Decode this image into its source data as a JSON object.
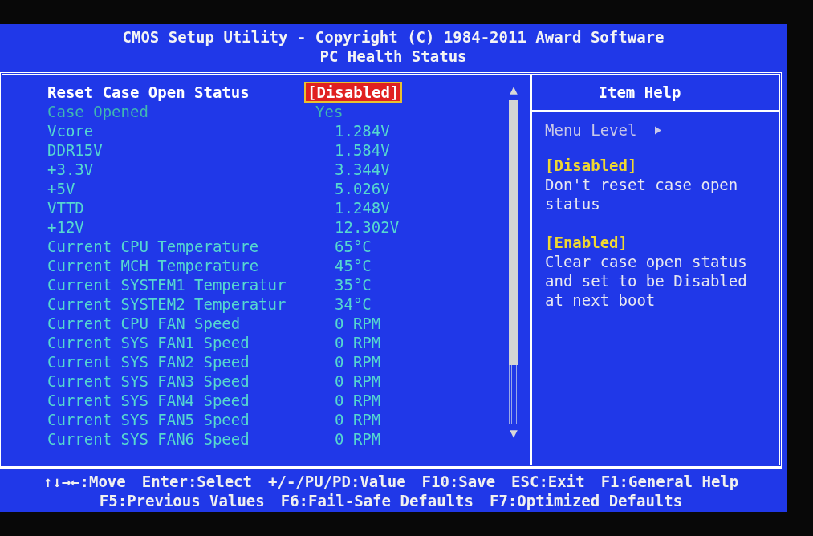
{
  "header": {
    "title": "CMOS Setup Utility - Copyright (C) 1984-2011 Award Software",
    "subtitle": "PC Health Status"
  },
  "items": [
    {
      "label": "Reset Case Open Status",
      "value": "[Disabled]",
      "selected": true,
      "disabled": false
    },
    {
      "label": "Case Opened",
      "value": "Yes",
      "selected": false,
      "disabled": true
    },
    {
      "label": "Vcore",
      "value": "1.284V",
      "selected": false,
      "disabled": false
    },
    {
      "label": "DDR15V",
      "value": "1.584V",
      "selected": false,
      "disabled": false
    },
    {
      "label": "+3.3V",
      "value": "3.344V",
      "selected": false,
      "disabled": false
    },
    {
      "label": "+5V",
      "value": "5.026V",
      "selected": false,
      "disabled": false
    },
    {
      "label": "VTTD",
      "value": "1.248V",
      "selected": false,
      "disabled": false
    },
    {
      "label": "+12V",
      "value": "12.302V",
      "selected": false,
      "disabled": false
    },
    {
      "label": "Current CPU Temperature",
      "value": "65°C",
      "selected": false,
      "disabled": false
    },
    {
      "label": "Current MCH Temperature",
      "value": "45°C",
      "selected": false,
      "disabled": false
    },
    {
      "label": "Current SYSTEM1 Temperatur",
      "value": "35°C",
      "selected": false,
      "disabled": false
    },
    {
      "label": "Current SYSTEM2 Temperatur",
      "value": "34°C",
      "selected": false,
      "disabled": false
    },
    {
      "label": "Current CPU FAN Speed",
      "value": "0 RPM",
      "selected": false,
      "disabled": false
    },
    {
      "label": "Current SYS FAN1 Speed",
      "value": "0 RPM",
      "selected": false,
      "disabled": false
    },
    {
      "label": "Current SYS FAN2 Speed",
      "value": "0 RPM",
      "selected": false,
      "disabled": false
    },
    {
      "label": "Current SYS FAN3 Speed",
      "value": "0 RPM",
      "selected": false,
      "disabled": false
    },
    {
      "label": "Current SYS FAN4 Speed",
      "value": "0 RPM",
      "selected": false,
      "disabled": false
    },
    {
      "label": "Current SYS FAN5 Speed",
      "value": "0 RPM",
      "selected": false,
      "disabled": false
    },
    {
      "label": "Current SYS FAN6 Speed",
      "value": "0 RPM",
      "selected": false,
      "disabled": false
    }
  ],
  "help": {
    "title": "Item Help",
    "menu_level": "Menu Level",
    "blocks": [
      {
        "heading": "[Disabled]",
        "text": "Don't reset case open status"
      },
      {
        "heading": "[Enabled]",
        "text": "Clear case open status and set to be Disabled at next boot"
      }
    ]
  },
  "footer": [
    [
      "↑↓→←:Move",
      "Enter:Select",
      "+/-/PU/PD:Value",
      "F10:Save",
      "ESC:Exit",
      "F1:General Help"
    ],
    [
      "F5:Previous Values",
      "F6:Fail-Safe Defaults",
      "F7:Optimized Defaults"
    ]
  ]
}
